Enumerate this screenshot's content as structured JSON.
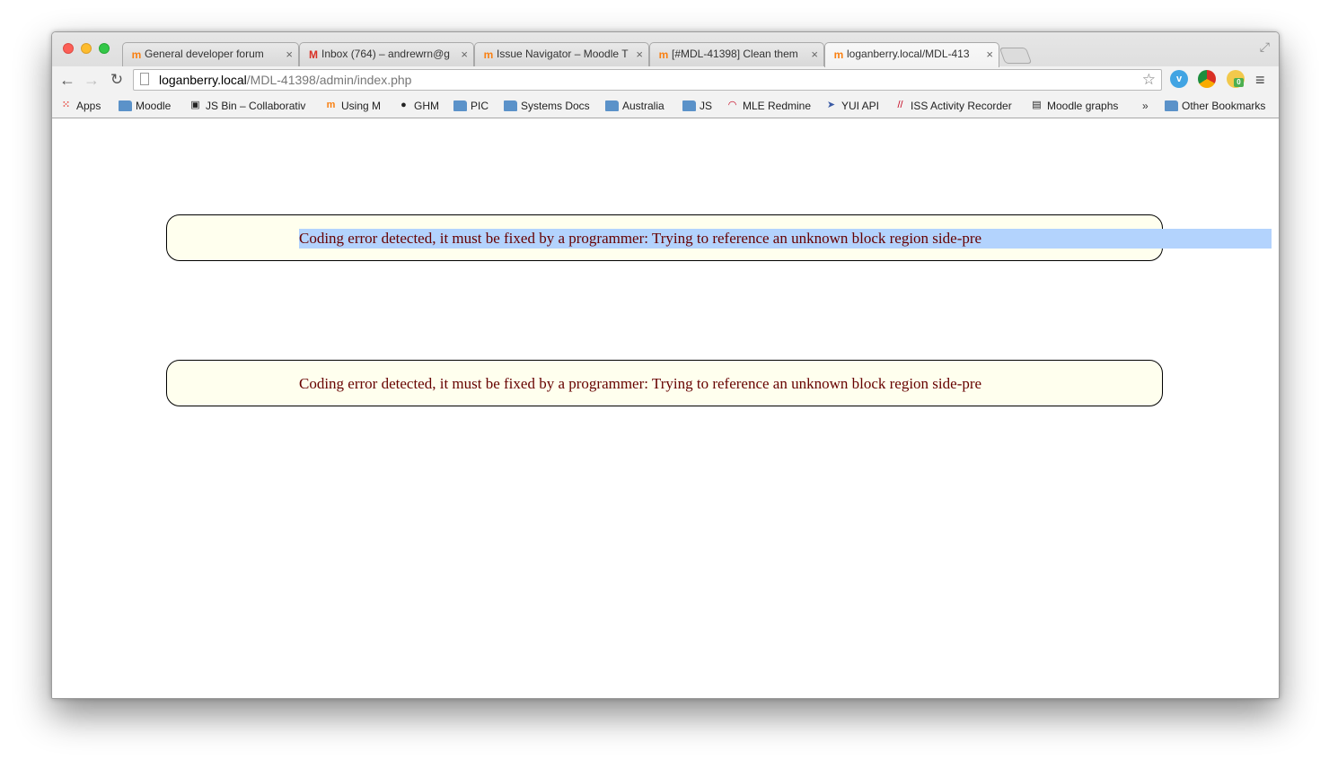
{
  "browser": {
    "tabs": [
      {
        "title": "General developer forum",
        "favicon": "moodle-icon",
        "active": false
      },
      {
        "title": "Inbox (764) – andrewrn@g",
        "favicon": "gmail-icon",
        "active": false
      },
      {
        "title": "Issue Navigator – Moodle T",
        "favicon": "moodle-icon",
        "active": false
      },
      {
        "title": "[#MDL-41398] Clean them",
        "favicon": "moodle-icon",
        "active": false
      },
      {
        "title": "loganberry.local/MDL-413",
        "favicon": "moodle-icon",
        "active": true
      }
    ],
    "url": {
      "host": "loganberry.local",
      "path": "/MDL-41398/admin/index.php"
    },
    "extensions": {
      "medal_badge": "0"
    },
    "bookmarks": [
      {
        "label": "Apps",
        "icon": "apps-grid-icon"
      },
      {
        "label": "Moodle",
        "icon": "folder-icon"
      },
      {
        "label": "JS Bin – Collaborativ",
        "icon": "jsbin-icon"
      },
      {
        "label": "Using M",
        "icon": "moodle-icon"
      },
      {
        "label": "GHM",
        "icon": "github-icon"
      },
      {
        "label": "PIC",
        "icon": "folder-icon"
      },
      {
        "label": "Systems Docs",
        "icon": "folder-icon"
      },
      {
        "label": "Australia",
        "icon": "folder-icon"
      },
      {
        "label": "JS",
        "icon": "folder-icon"
      },
      {
        "label": "MLE Redmine",
        "icon": "redmine-icon"
      },
      {
        "label": "YUI API",
        "icon": "yui-icon"
      },
      {
        "label": "ISS Activity Recorder",
        "icon": "iss-icon"
      },
      {
        "label": "Moodle graphs",
        "icon": "munin-icon"
      }
    ],
    "more_bookmarks": "»",
    "other_bookmarks": "Other Bookmarks"
  },
  "page": {
    "errors": [
      {
        "message": "Coding error detected, it must be fixed by a programmer: Trying to reference an unknown block region side-pre",
        "selected": true
      },
      {
        "message": "Coding error detected, it must be fixed by a programmer: Trying to reference an unknown block region side-pre",
        "selected": false
      }
    ]
  },
  "colors": {
    "error_text": "#660000",
    "error_background": "#ffffee",
    "selection": "#b3d3fd"
  }
}
